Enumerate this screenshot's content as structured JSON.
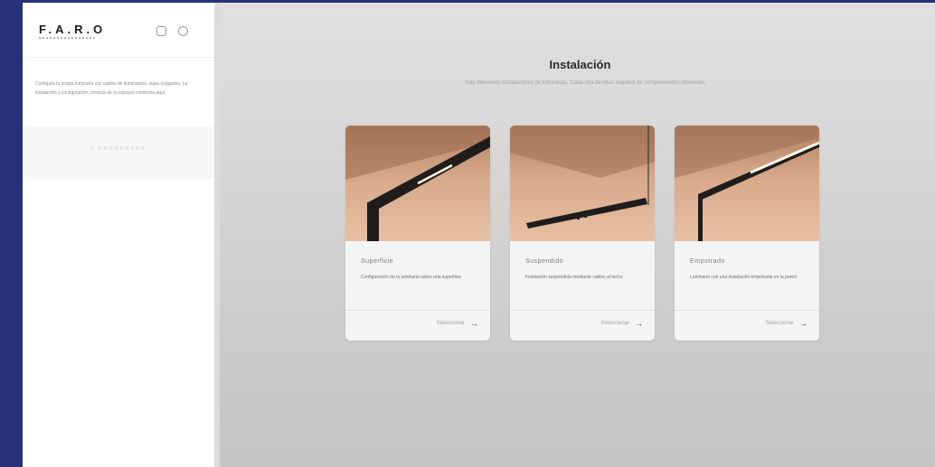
{
  "brand": {
    "logo": "F.A.R.O",
    "tagline": "BARCELONA"
  },
  "sidebar": {
    "description": "Configura tu propia luminaria con cables de iluminación, vigas colgantes. La instalación y configuración correcta de tu espacio comienza aquí.",
    "products_button": "0 PRODUCTOS"
  },
  "main": {
    "title": "Instalación",
    "subtitle": "Hay diferentes instalaciones de luminarias. Cada una de ellas requiere de complementos diferentes."
  },
  "cards": [
    {
      "name": "Superficie",
      "description": "Configuración de la luminaria sobre una superficie",
      "select_label": "Seleccionar"
    },
    {
      "name": "Suspendido",
      "description": "Instalación suspendida mediante cables al techo",
      "select_label": "Seleccionar"
    },
    {
      "name": "Empotrado",
      "description": "Luminaria con una instalación empotrada en la pared",
      "select_label": "Seleccionar"
    }
  ],
  "icons": {
    "header_left": "square-icon",
    "header_right": "cart-icon",
    "select_arrow": "arrow-right-icon"
  },
  "colors": {
    "background": "#27317a",
    "accent": "#2a2a2a"
  }
}
